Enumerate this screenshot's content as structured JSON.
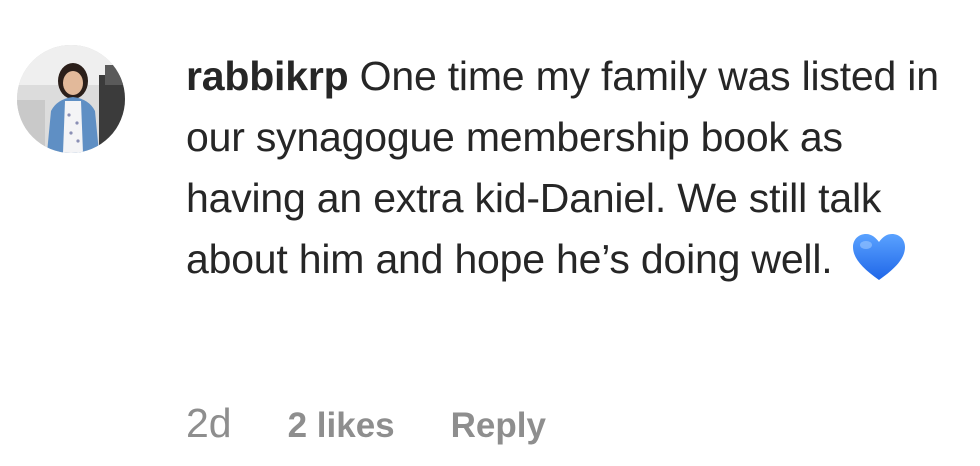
{
  "comment": {
    "username": "rabbikrp",
    "text": "One time my family was listed in our synagogue membership book as having an extra kid-Daniel. We still talk about him and hope he’s doing well.",
    "emoji": "blue-heart-icon",
    "time": "2d",
    "likes": "2 likes",
    "reply": "Reply"
  },
  "colors": {
    "text": "#262626",
    "meta": "#8e8e8e",
    "heart": "#2f7cf6"
  }
}
